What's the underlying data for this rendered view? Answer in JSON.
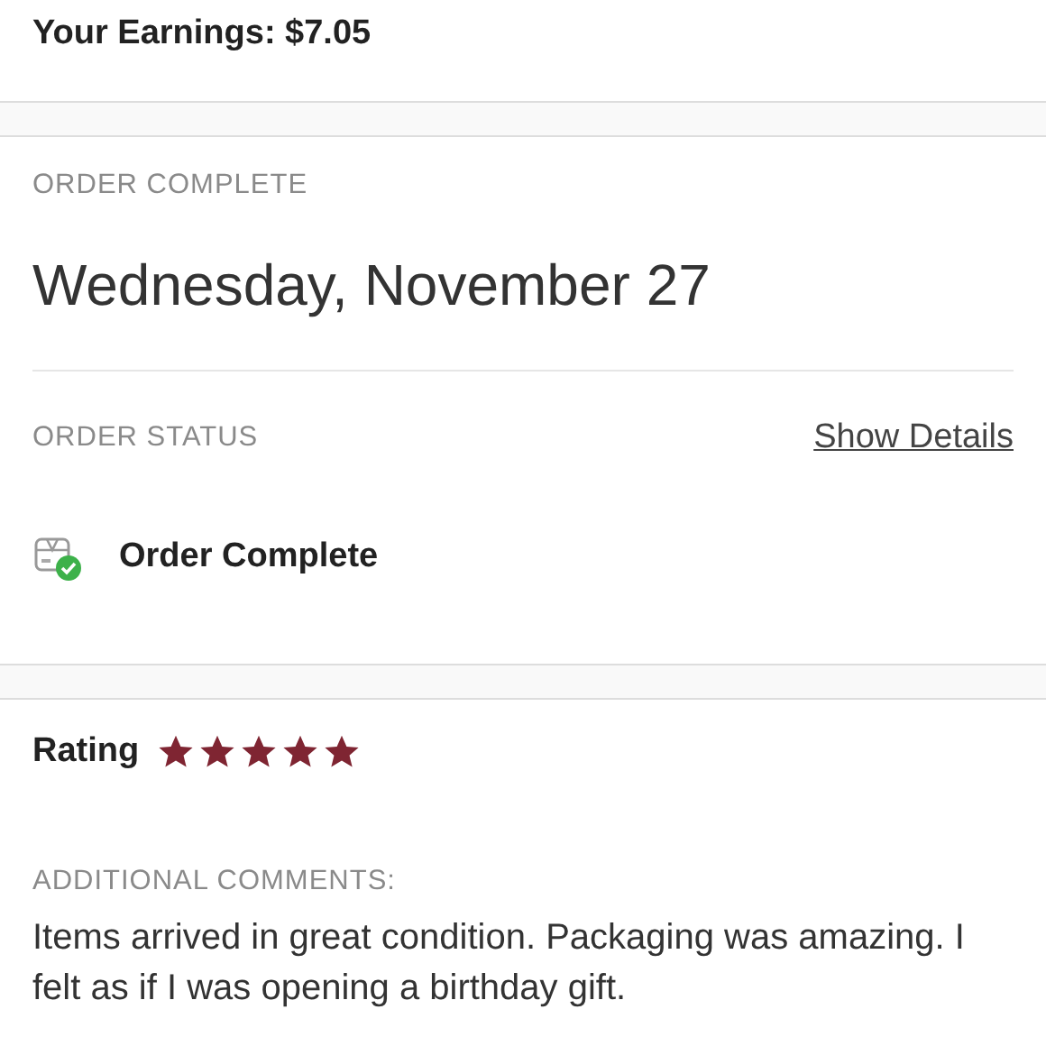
{
  "earnings": {
    "text": "Your Earnings: $7.05"
  },
  "order": {
    "label": "ORDER COMPLETE",
    "date": "Wednesday, November 27"
  },
  "status": {
    "label": "ORDER STATUS",
    "link": "Show Details",
    "text": "Order Complete"
  },
  "rating": {
    "label": "Rating",
    "stars": 5
  },
  "comments": {
    "label": "ADDITIONAL COMMENTS:",
    "text": "Items arrived in great condition. Packaging was amazing. I felt as if I was opening a birthday gift."
  }
}
